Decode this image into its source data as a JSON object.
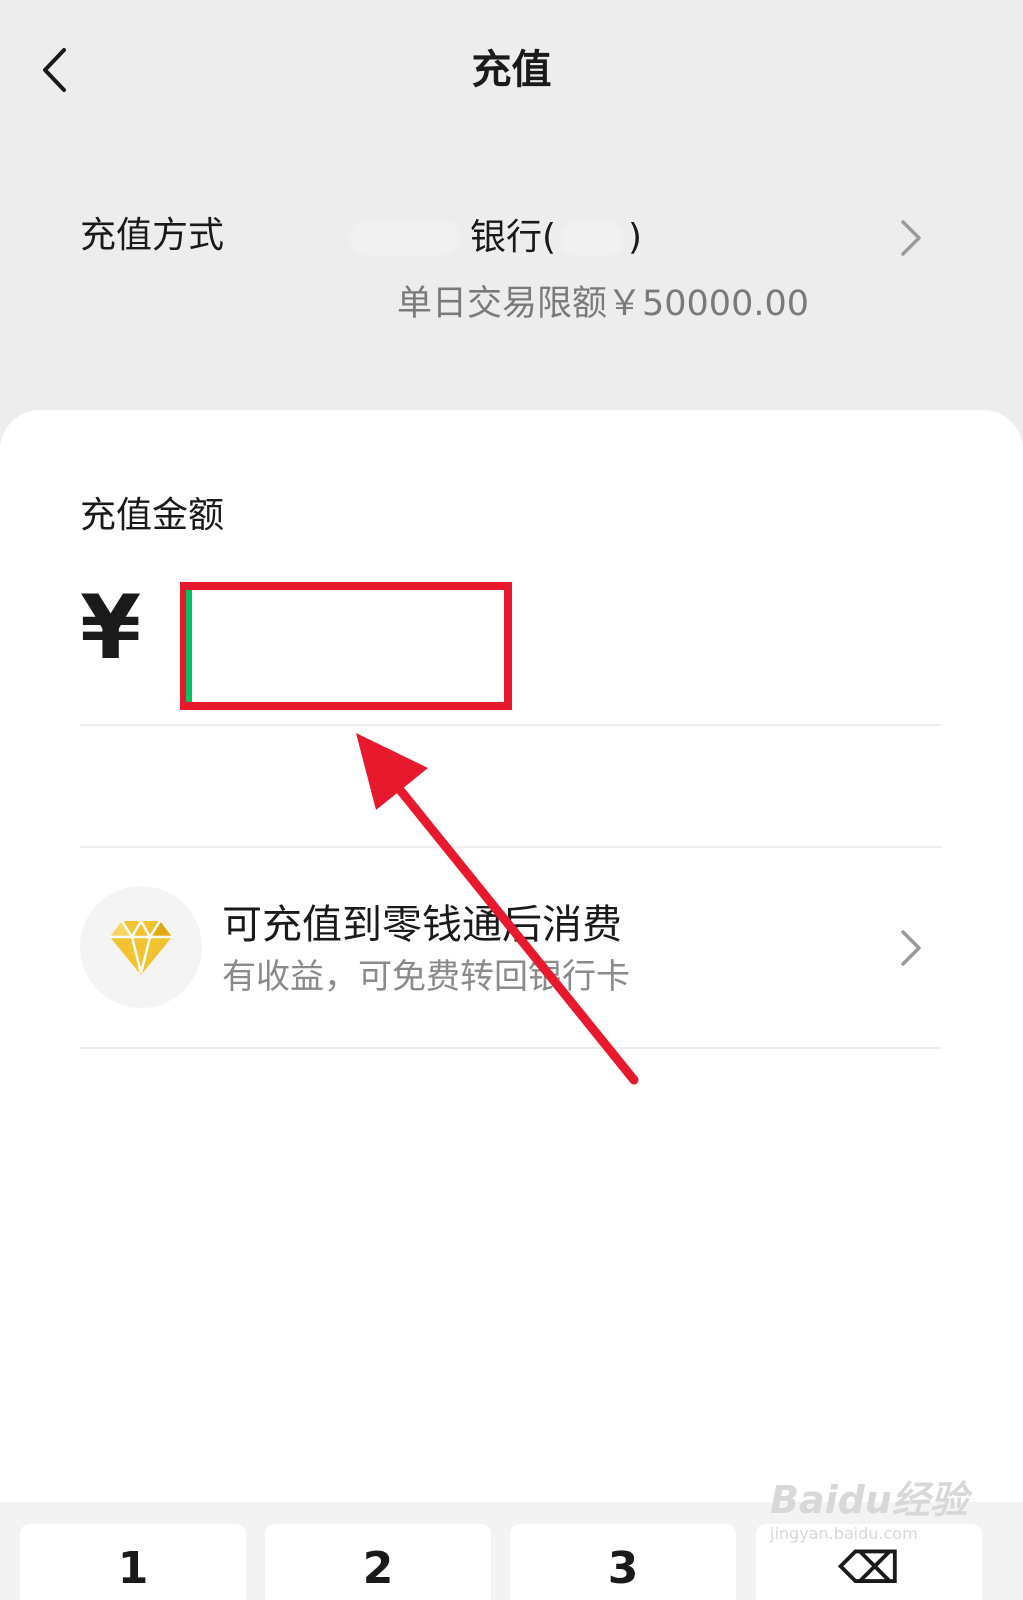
{
  "header": {
    "title": "充值"
  },
  "payment_method": {
    "label": "充值方式",
    "bank": "银行(",
    "bank_tail": ")",
    "limit": "单日交易限额￥50000.00"
  },
  "amount": {
    "label": "充值金额",
    "currency_symbol": "¥",
    "value": ""
  },
  "promo": {
    "title": "可充值到零钱通后消费",
    "subtitle": "有收益，可免费转回银行卡"
  },
  "keypad": {
    "keys": [
      "1",
      "2",
      "3",
      "⌫"
    ]
  },
  "watermark": {
    "logo": "Baidu经验",
    "url": "jingyan.baidu.com"
  },
  "colors": {
    "highlight_red": "#e8192c",
    "caret_green": "#07c160",
    "diamond_gold": "#f2c230"
  },
  "icons": {
    "back": "chevron-left-icon",
    "row_arrow": "chevron-right-icon",
    "promo": "diamond-icon"
  }
}
